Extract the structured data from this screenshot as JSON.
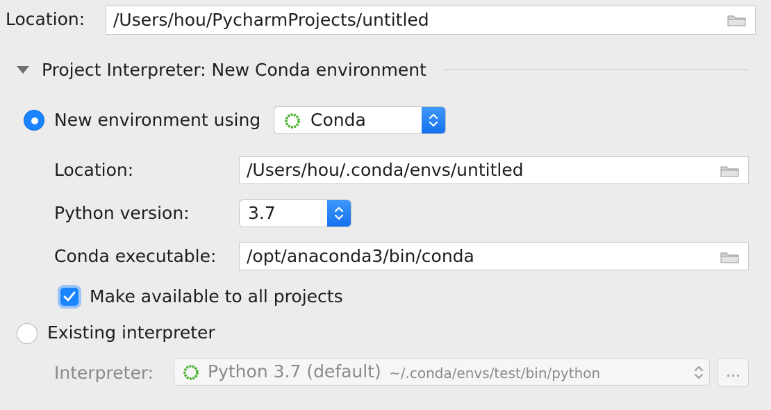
{
  "project": {
    "location_label": "Location:",
    "location_value": "/Users/hou/PycharmProjects/untitled"
  },
  "interpreter_section": {
    "title": "Project Interpreter: New Conda environment"
  },
  "new_env": {
    "radio_label": "New environment using",
    "tool_value": "Conda",
    "location_label": "Location:",
    "location_value": "/Users/hou/.conda/envs/untitled",
    "python_version_label": "Python version:",
    "python_version_value": "3.7",
    "conda_exec_label": "Conda executable:",
    "conda_exec_value": "/opt/anaconda3/bin/conda",
    "make_available_label": "Make available to all projects",
    "make_available_checked": true
  },
  "existing": {
    "radio_label": "Existing interpreter",
    "interpreter_label": "Interpreter:",
    "interpreter_name": "Python 3.7 (default)",
    "interpreter_path": "~/.conda/envs/test/bin/python",
    "browse_label": "..."
  },
  "colors": {
    "accent": "#1a84ff",
    "conda_green": "#43b02a",
    "background": "#ececec"
  }
}
